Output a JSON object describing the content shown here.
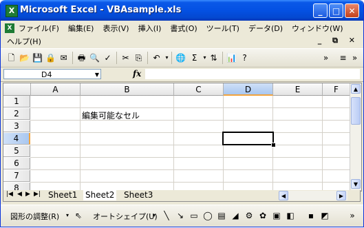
{
  "window": {
    "title": "Microsoft Excel - VBAsample.xls",
    "app_icon_label": "X"
  },
  "window_buttons": {
    "minimize": "_",
    "maximize": "□",
    "close": "✕"
  },
  "menu": {
    "items": [
      "ファイル(F)",
      "編集(E)",
      "表示(V)",
      "挿入(I)",
      "書式(O)",
      "ツール(T)",
      "データ(D)",
      "ウィンドウ(W)"
    ],
    "help": "ヘルプ(H)"
  },
  "mdi_buttons": "_ ⧉ ✕",
  "namebox": {
    "value": "D4"
  },
  "formula": {
    "fx_label": "fx",
    "value": ""
  },
  "columns": [
    "A",
    "B",
    "C",
    "D",
    "E",
    "F"
  ],
  "rows": [
    "1",
    "2",
    "3",
    "4",
    "5",
    "6",
    "7",
    "8"
  ],
  "cells": {
    "B2": "編集可能なセル"
  },
  "active_cell": "D4",
  "sheets": [
    "Sheet1",
    "Sheet2",
    "Sheet3"
  ],
  "active_sheet": "Sheet2",
  "drawing": {
    "adjust_label": "図形の調整(R)",
    "autoshape_label": "オートシェイプ(U)"
  },
  "colors": {
    "title_bar": "#0451e3",
    "selection_header": "#a9c7f0",
    "selection_accent": "#f2a33c"
  }
}
